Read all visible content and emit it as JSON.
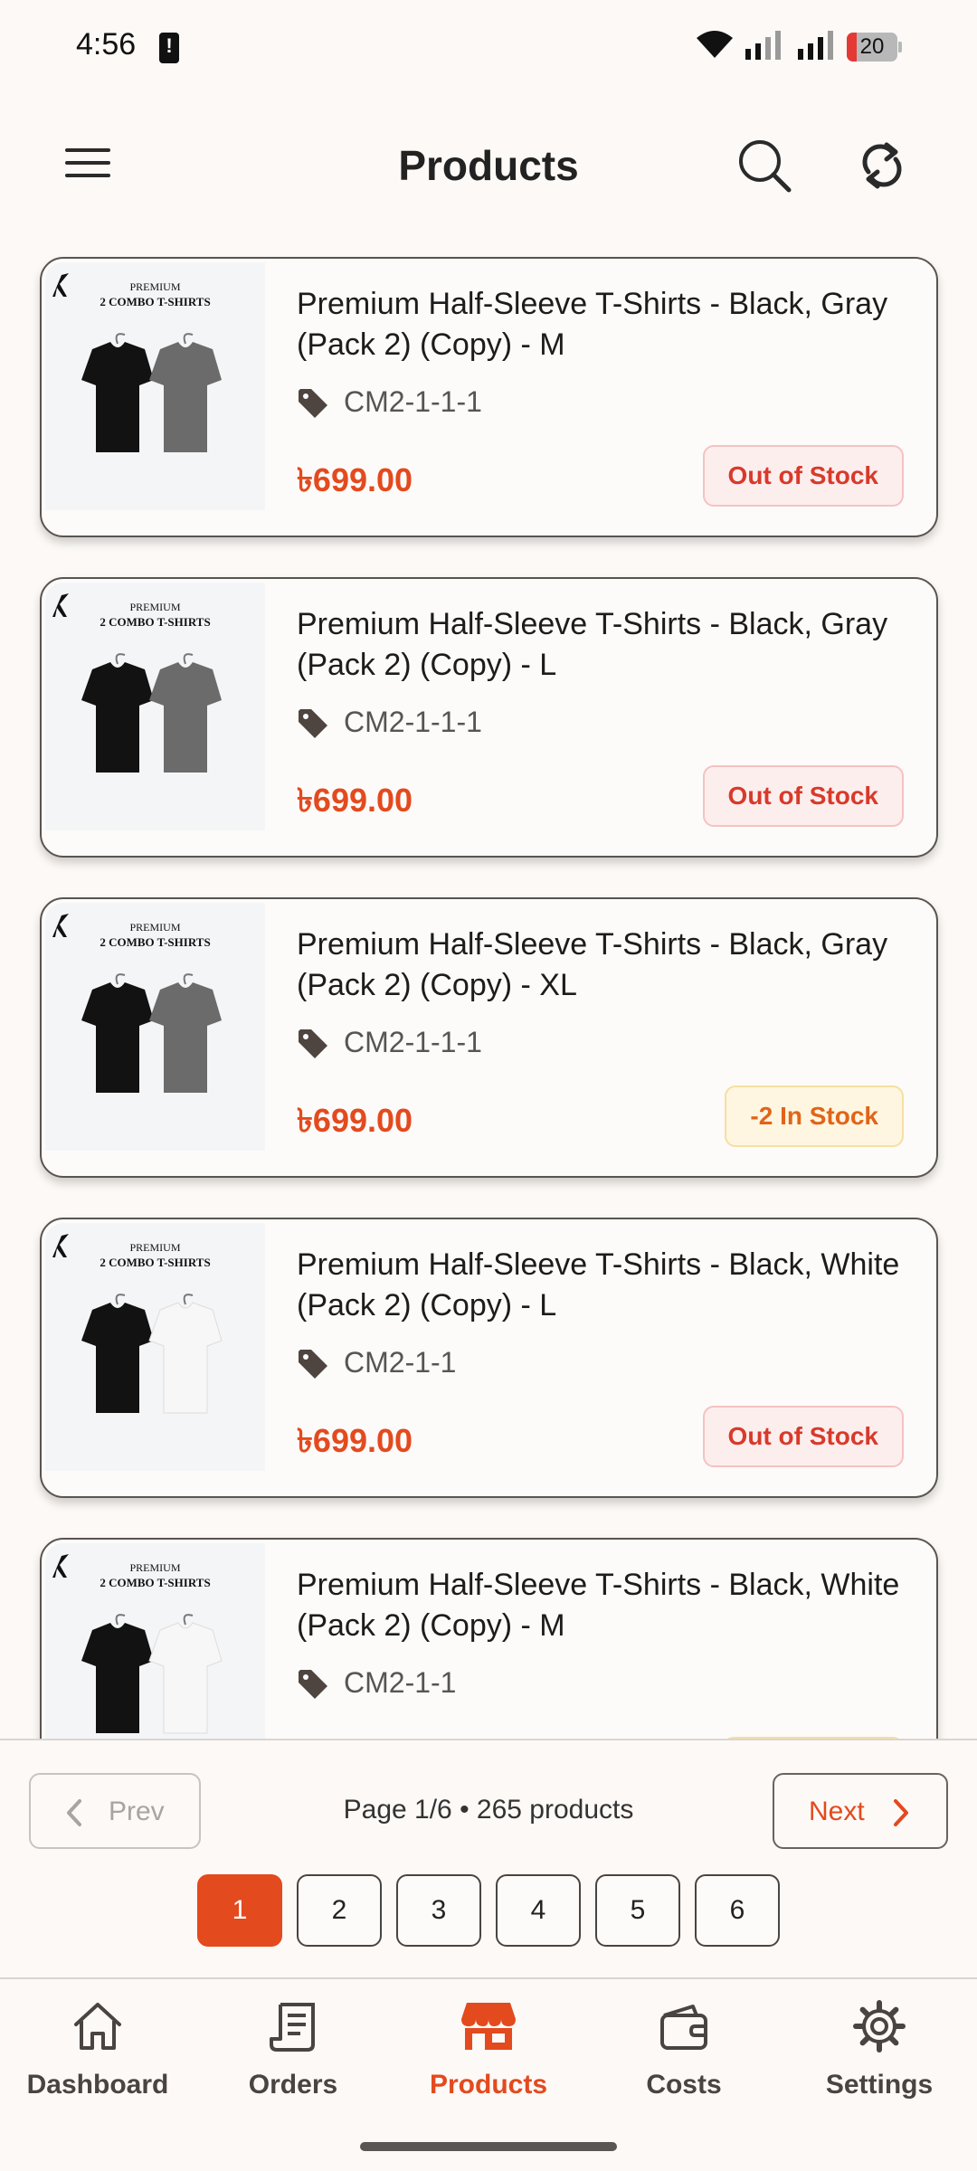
{
  "status_bar": {
    "time": "4:56",
    "battery_level": "20",
    "icons": [
      "battery-alert-icon",
      "wifi-icon",
      "signal-icon",
      "signal-icon",
      "battery-icon"
    ]
  },
  "header": {
    "title": "Products",
    "icons": [
      "menu-icon",
      "search-icon",
      "refresh-icon"
    ]
  },
  "thumbnail": {
    "line1": "PREMIUM",
    "line2": "2 COMBO T-SHIRTS"
  },
  "products": [
    {
      "name": "Premium Half-Sleeve T-Shirts - Black, Gray (Pack 2) (Copy) - M",
      "sku": "CM2-1-1-1",
      "price": "৳699.00",
      "stock": "Out of Stock",
      "stock_type": "out",
      "shirt2_color": "#6b6b6b"
    },
    {
      "name": "Premium Half-Sleeve T-Shirts - Black, Gray (Pack 2) (Copy) - L",
      "sku": "CM2-1-1-1",
      "price": "৳699.00",
      "stock": "Out of Stock",
      "stock_type": "out",
      "shirt2_color": "#6b6b6b"
    },
    {
      "name": "Premium Half-Sleeve T-Shirts - Black, Gray (Pack 2) (Copy) - XL",
      "sku": "CM2-1-1-1",
      "price": "৳699.00",
      "stock": "-2 In Stock",
      "stock_type": "low",
      "shirt2_color": "#6b6b6b"
    },
    {
      "name": "Premium Half-Sleeve T-Shirts - Black, White (Pack 2) (Copy) - L",
      "sku": "CM2-1-1",
      "price": "৳699.00",
      "stock": "Out of Stock",
      "stock_type": "out",
      "shirt2_color": "#f7f7f7"
    },
    {
      "name": "Premium Half-Sleeve T-Shirts - Black, White (Pack 2) (Copy) - M",
      "sku": "CM2-1-1",
      "shirt2_color": "#f7f7f7"
    }
  ],
  "pagination": {
    "prev_label": "Prev",
    "next_label": "Next",
    "info": "Page 1/6 • 265 products",
    "pages": [
      "1",
      "2",
      "3",
      "4",
      "5",
      "6"
    ],
    "current_page": "1"
  },
  "bottom_nav": [
    {
      "label": "Dashboard",
      "icon": "home-icon",
      "active": false
    },
    {
      "label": "Orders",
      "icon": "receipt-icon",
      "active": false
    },
    {
      "label": "Products",
      "icon": "store-icon",
      "active": true
    },
    {
      "label": "Costs",
      "icon": "wallet-icon",
      "active": false
    },
    {
      "label": "Settings",
      "icon": "gear-icon",
      "active": false
    }
  ],
  "colors": {
    "accent": "#E34A1E",
    "background": "#FCF9F6",
    "out_of_stock_bg": "#FDEEEE",
    "low_stock_bg": "#FEF6E0"
  }
}
